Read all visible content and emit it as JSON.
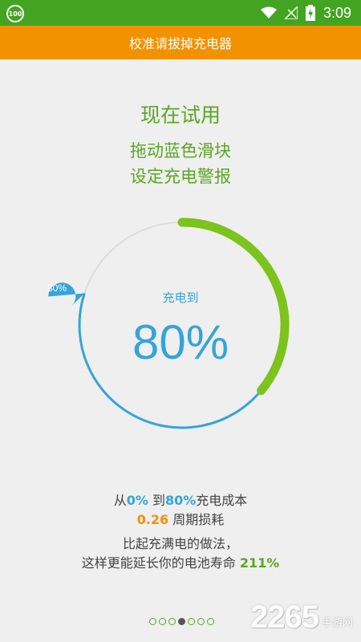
{
  "status_bar": {
    "badge": "100",
    "time": "3:09",
    "icons": [
      "wifi-icon",
      "signal-icon",
      "battery-charging-icon"
    ]
  },
  "header": {
    "title": "校准请拔掉充电器"
  },
  "main": {
    "title": "现在试用",
    "subtitle_line1": "拖动蓝色滑块",
    "subtitle_line2": "设定充电警报",
    "dial": {
      "label": "充电到",
      "value": "80%",
      "handle_label": "80%",
      "current_level": 0.36,
      "target_level": 0.8,
      "colors": {
        "current": "#7cc31c",
        "target": "#35a4d8",
        "track": "#dcdcdc"
      }
    },
    "info": {
      "line1_prefix": "从",
      "line1_from": "0%",
      "line1_to_word": " 到",
      "line1_to": "80%",
      "line1_suffix": "充电成本",
      "line2_value": "0.26",
      "line2_suffix": " 周期损耗",
      "line3": "比起充满电的做法，",
      "line4_prefix": "这样更能延长你的电池寿命 ",
      "line4_value": "211%"
    }
  },
  "pager": {
    "count": 7,
    "active_index": 3
  },
  "watermark": {
    "number": "2265",
    "site": "手游网"
  }
}
